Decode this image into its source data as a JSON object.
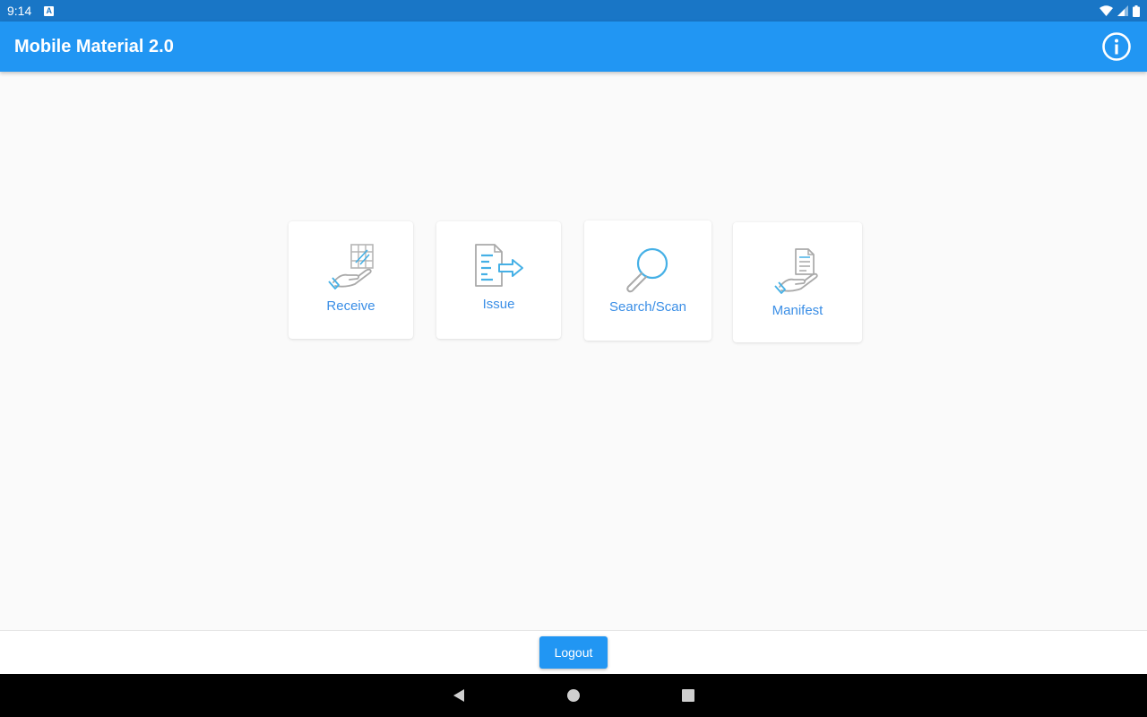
{
  "status_bar": {
    "time": "9:14",
    "notification_badge": "A"
  },
  "app_bar": {
    "title": "Mobile Material 2.0",
    "info_icon": "info-circle-icon"
  },
  "tiles": [
    {
      "label": "Receive",
      "icon": "receive-hand-icon"
    },
    {
      "label": "Issue",
      "icon": "issue-document-arrow-icon"
    },
    {
      "label": "Search/Scan",
      "icon": "magnifier-icon"
    },
    {
      "label": "Manifest",
      "icon": "manifest-hand-document-icon"
    }
  ],
  "bottom": {
    "logout_label": "Logout"
  },
  "colors": {
    "status_bar": "#1976c6",
    "app_bar": "#2196f3",
    "accent": "#3a8ee6",
    "icon_gray": "#a9a9a9",
    "icon_blue": "#45b0e6"
  }
}
